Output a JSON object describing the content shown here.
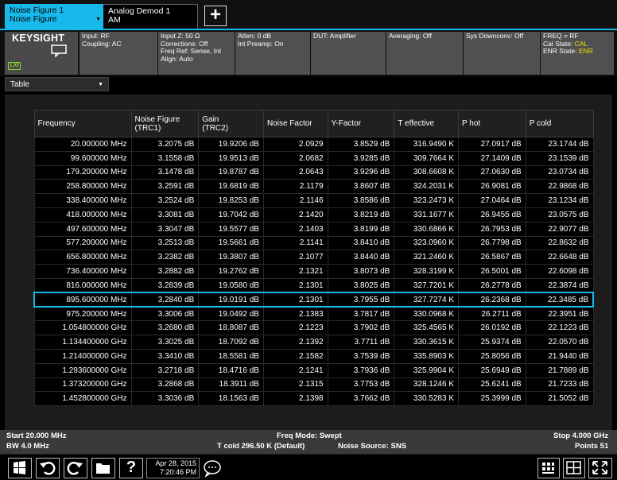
{
  "tabs": [
    {
      "line1": "Noise Figure 1",
      "line2": "Noise Figure",
      "active": true
    },
    {
      "line1": "Analog Demod 1",
      "line2": "AM",
      "active": false
    }
  ],
  "add_tab_label": "+",
  "brand": "KEYSIGHT",
  "lxi": "LXI",
  "settings": {
    "input": [
      "Input: RF",
      "Coupling: AC"
    ],
    "input_z": [
      "Input Z: 50 Ω",
      "Corrections: Off",
      "Freq Ref: Sense, Int",
      "Align: Auto"
    ],
    "atten": [
      "Atten: 0 dB",
      "Int Preamp: On"
    ],
    "dut": "DUT: Amplifier",
    "averaging": "Averaging: Off",
    "sys_downconv": "Sys Downconv: Off",
    "freq": "FREQ = RF",
    "cal_state_label": "Cal State: ",
    "cal_state_value": "CAL",
    "enr_state_label": "ENR State: ",
    "enr_state_value": "ENR"
  },
  "view": {
    "selected": "Table"
  },
  "table": {
    "headers": [
      [
        "Frequency",
        ""
      ],
      [
        "Noise Figure",
        "(TRC1)"
      ],
      [
        "Gain",
        "(TRC2)"
      ],
      [
        "Noise Factor",
        ""
      ],
      [
        "Y-Factor",
        ""
      ],
      [
        "T effective",
        ""
      ],
      [
        "P hot",
        ""
      ],
      [
        "P cold",
        ""
      ]
    ],
    "selected_row": 11,
    "rows": [
      [
        "20.000000 MHz",
        "3.2075 dB",
        "19.9206 dB",
        "2.0929",
        "3.8529 dB",
        "316.9490 K",
        "27.0917 dB",
        "23.1744 dB"
      ],
      [
        "99.600000 MHz",
        "3.1558 dB",
        "19.9513 dB",
        "2.0682",
        "3.9285 dB",
        "309.7664 K",
        "27.1409 dB",
        "23.1539 dB"
      ],
      [
        "179.200000 MHz",
        "3.1478 dB",
        "19.8787 dB",
        "2.0643",
        "3.9296 dB",
        "308.6608 K",
        "27.0630 dB",
        "23.0734 dB"
      ],
      [
        "258.800000 MHz",
        "3.2591 dB",
        "19.6819 dB",
        "2.1179",
        "3.8607 dB",
        "324.2031 K",
        "26.9081 dB",
        "22.9868 dB"
      ],
      [
        "338.400000 MHz",
        "3.2524 dB",
        "19.8253 dB",
        "2.1146",
        "3.8586 dB",
        "323.2473 K",
        "27.0464 dB",
        "23.1234 dB"
      ],
      [
        "418.000000 MHz",
        "3.3081 dB",
        "19.7042 dB",
        "2.1420",
        "3.8219 dB",
        "331.1677 K",
        "26.9455 dB",
        "23.0575 dB"
      ],
      [
        "497.600000 MHz",
        "3.3047 dB",
        "19.5577 dB",
        "2.1403",
        "3.8199 dB",
        "330.6866 K",
        "26.7953 dB",
        "22.9077 dB"
      ],
      [
        "577.200000 MHz",
        "3.2513 dB",
        "19.5661 dB",
        "2.1141",
        "3.8410 dB",
        "323.0960 K",
        "26.7798 dB",
        "22.8632 dB"
      ],
      [
        "656.800000 MHz",
        "3.2382 dB",
        "19.3807 dB",
        "2.1077",
        "3.8440 dB",
        "321.2460 K",
        "26.5867 dB",
        "22.6648 dB"
      ],
      [
        "736.400000 MHz",
        "3.2882 dB",
        "19.2762 dB",
        "2.1321",
        "3.8073 dB",
        "328.3199 K",
        "26.5001 dB",
        "22.6098 dB"
      ],
      [
        "816.000000 MHz",
        "3.2839 dB",
        "19.0580 dB",
        "2.1301",
        "3.8025 dB",
        "327.7201 K",
        "26.2778 dB",
        "22.3874 dB"
      ],
      [
        "895.600000 MHz",
        "3.2840 dB",
        "19.0191 dB",
        "2.1301",
        "3.7955 dB",
        "327.7274 K",
        "26.2368 dB",
        "22.3485 dB"
      ],
      [
        "975.200000 MHz",
        "3.3006 dB",
        "19.0492 dB",
        "2.1383",
        "3.7817 dB",
        "330.0968 K",
        "26.2711 dB",
        "22.3951 dB"
      ],
      [
        "1.054800000 GHz",
        "3.2680 dB",
        "18.8087 dB",
        "2.1223",
        "3.7902 dB",
        "325.4565 K",
        "26.0192 dB",
        "22.1223 dB"
      ],
      [
        "1.134400000 GHz",
        "3.3025 dB",
        "18.7092 dB",
        "2.1392",
        "3.7711 dB",
        "330.3615 K",
        "25.9374 dB",
        "22.0570 dB"
      ],
      [
        "1.214000000 GHz",
        "3.3410 dB",
        "18.5581 dB",
        "2.1582",
        "3.7539 dB",
        "335.8903 K",
        "25.8056 dB",
        "21.9440 dB"
      ],
      [
        "1.293600000 GHz",
        "3.2718 dB",
        "18.4716 dB",
        "2.1241",
        "3.7936 dB",
        "325.9904 K",
        "25.6949 dB",
        "21.7889 dB"
      ],
      [
        "1.373200000 GHz",
        "3.2868 dB",
        "18.3911 dB",
        "2.1315",
        "3.7753 dB",
        "328.1246 K",
        "25.6241 dB",
        "21.7233 dB"
      ],
      [
        "1.452800000 GHz",
        "3.3036 dB",
        "18.1563 dB",
        "2.1398",
        "3.7662 dB",
        "330.5283 K",
        "25.3999 dB",
        "21.5052 dB"
      ]
    ]
  },
  "status": {
    "start": "Start 20.000 MHz",
    "bw": "BW 4.0 MHz",
    "freq_mode": "Freq Mode: Swept",
    "t_cold": "T cold 296.50 K (Default)",
    "noise_source": "Noise Source: SNS",
    "stop": "Stop 4.000 GHz",
    "points": "Points 51"
  },
  "taskbar": {
    "date": "Apr 28, 2015",
    "time": "7:20:46 PM",
    "help_label": "?"
  },
  "colors": {
    "accent": "#17b9ea",
    "highlight": "#f0e600",
    "lxi": "#8ad12b"
  }
}
